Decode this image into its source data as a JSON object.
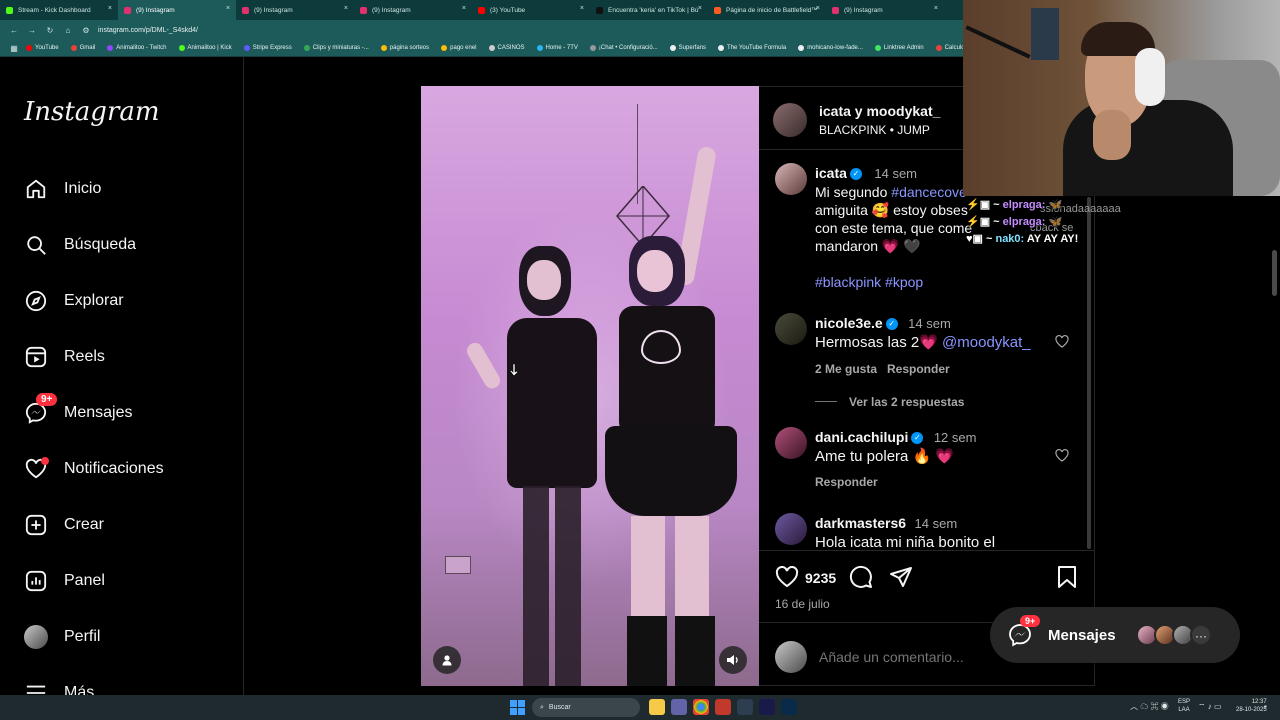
{
  "browser": {
    "tabs": [
      {
        "label": "Stream - Kick Dashboard",
        "color": "#53fc18"
      },
      {
        "label": "(9) Instagram",
        "color": "#e1306c"
      },
      {
        "label": "(9) Instagram",
        "color": "#e1306c"
      },
      {
        "label": "(9) Instagram",
        "color": "#e1306c"
      },
      {
        "label": "(3) YouTube",
        "color": "#ff0000"
      },
      {
        "label": "Encuentra 'keria' en TikTok | Bú",
        "color": "#111111"
      },
      {
        "label": "Página de inicio de Battlefield™",
        "color": "#ff5a1f"
      },
      {
        "label": "(9) Instagram",
        "color": "#e1306c"
      }
    ],
    "url": "instagram.com/p/DML-_S4skd4/",
    "bookmarks": [
      {
        "label": "YouTube",
        "color": "#ff0000"
      },
      {
        "label": "Gmail",
        "color": "#ea4335"
      },
      {
        "label": "Animalitoo - Twitch",
        "color": "#9146ff"
      },
      {
        "label": "Animalitoo | Kick",
        "color": "#53fc18"
      },
      {
        "label": "Stripe Express",
        "color": "#635bff"
      },
      {
        "label": "Clips y miniaturas -...",
        "color": "#34a853"
      },
      {
        "label": "página sorteos",
        "color": "#fbbc05"
      },
      {
        "label": "pago enel",
        "color": "#fbbc05"
      },
      {
        "label": "CASINOS",
        "color": "#cccccc"
      },
      {
        "label": "Home - 7TV",
        "color": "#29b6f6"
      },
      {
        "label": "¡Chat • Configuració...",
        "color": "#999999"
      },
      {
        "label": "Superfans",
        "color": "#eeeeee"
      },
      {
        "label": "The YouTube Formula",
        "color": "#eeeeee"
      },
      {
        "label": "mohicano-low-fade...",
        "color": "#eeeeee"
      },
      {
        "label": "Linktree Admin",
        "color": "#43e660"
      },
      {
        "label": "Calculo de Bo",
        "color": "#ea4335"
      }
    ]
  },
  "sidebar": {
    "logo": "Instagram",
    "items": [
      {
        "label": "Inicio",
        "icon": "home-icon"
      },
      {
        "label": "Búsqueda",
        "icon": "search-icon"
      },
      {
        "label": "Explorar",
        "icon": "compass-icon"
      },
      {
        "label": "Reels",
        "icon": "reels-icon"
      },
      {
        "label": "Mensajes",
        "icon": "messenger-icon",
        "badge": "9+"
      },
      {
        "label": "Notificaciones",
        "icon": "heart-icon"
      },
      {
        "label": "Crear",
        "icon": "plus-square-icon"
      },
      {
        "label": "Panel",
        "icon": "chart-icon"
      },
      {
        "label": "Perfil",
        "icon": "avatar-icon"
      },
      {
        "label": "Más",
        "icon": "menu-icon"
      }
    ]
  },
  "post": {
    "header_user": "icata y moodykat_",
    "header_sub": "BLACKPINK • JUMP",
    "caption": {
      "user": "icata",
      "time": "14 sem",
      "text1": "Mi segundo ",
      "hashtag1": "#dancecove",
      "text2": "amiguita 🥰 estoy obses",
      "text3": "con este tema, que come",
      "text4": "mandaron 💗 🖤",
      "hashtags": "#blackpink #kpop"
    },
    "comments": [
      {
        "user": "nicole3e.e",
        "time": "14 sem",
        "text": "Hermosas las 2💗 ",
        "mention": "@moodykat_",
        "likes": "2 Me gusta",
        "reply": "Responder",
        "view_replies": "Ver las 2 respuestas"
      },
      {
        "user": "dani.cachilupi",
        "time": "12 sem",
        "text": "Ame tu polera 🔥 💗",
        "reply": "Responder"
      },
      {
        "user": "darkmasters6",
        "time": "14 sem",
        "text": "Hola icata mi niña bonito el"
      }
    ],
    "likes": "9235",
    "date": "16 de julio",
    "add_comment_placeholder": "Añade un comentario..."
  },
  "chat": [
    {
      "nick": "elpraga:",
      "text": "🦋"
    },
    {
      "nick": "elpraga:",
      "text": "🦋"
    },
    {
      "nick": "nak0:",
      "text": "AY AY AY!"
    }
  ],
  "chat_under": {
    "a": "sionadaaaaaaa",
    "b": "back se"
  },
  "messages_pill": {
    "label": "Mensajes",
    "badge": "9+"
  },
  "taskbar": {
    "search": "Buscar",
    "lang": "ESP",
    "lang2": "LAA",
    "time": "12:37",
    "date": "28-10-2025"
  }
}
